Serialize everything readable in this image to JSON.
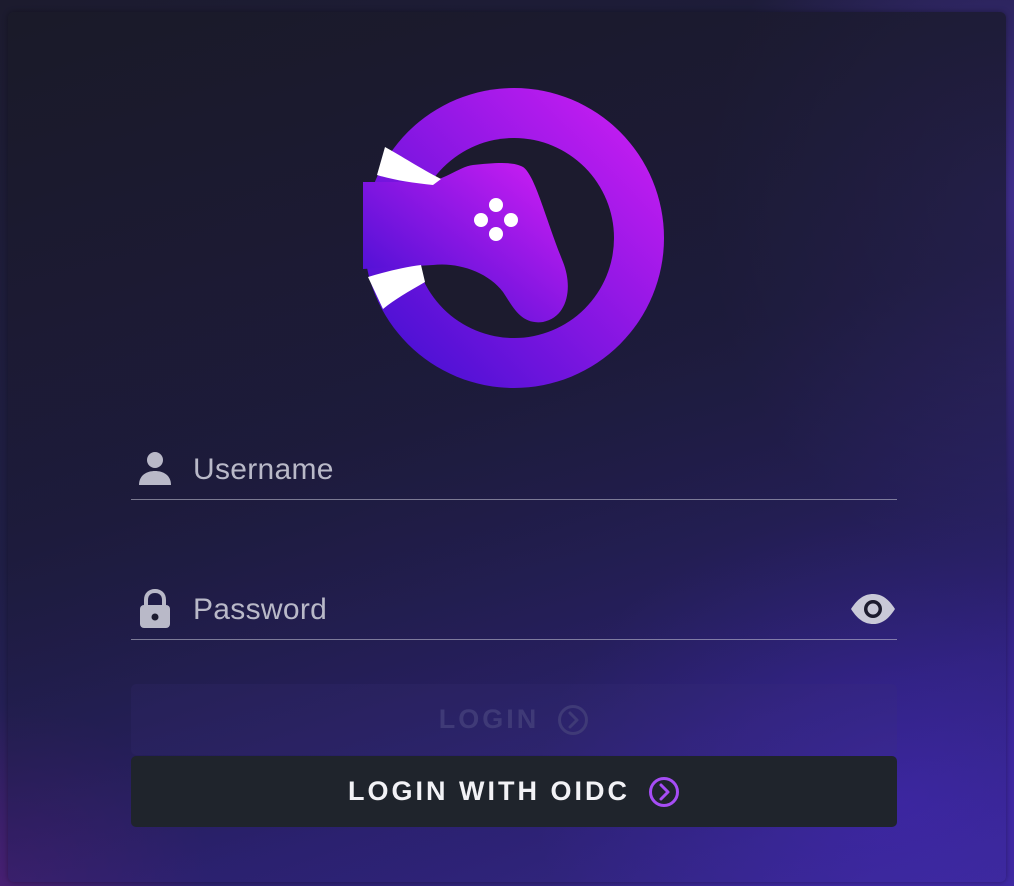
{
  "login_form": {
    "username_placeholder": "Username",
    "password_placeholder": "Password",
    "login_button_label": "LOGIN",
    "oidc_button_label": "LOGIN WITH OIDC"
  },
  "icons": {
    "logo": "gamepad-ring-logo",
    "username": "person-icon",
    "password": "lock-icon",
    "visibility": "eye-icon",
    "button_chevron": "chevron-right-circle-icon"
  },
  "colors": {
    "accent": "#9b3cf0",
    "logo_gradient_start": "#3a0fd0",
    "logo_gradient_end": "#d41ef5",
    "disabled_text": "#3f3a77",
    "oidc_button_bg": "#1f242c"
  }
}
